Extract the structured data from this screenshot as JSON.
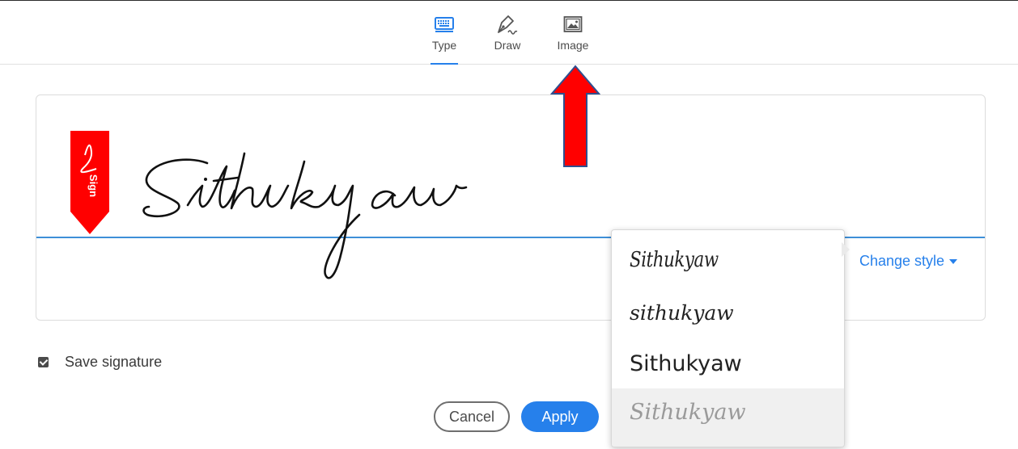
{
  "tabs": [
    {
      "label": "Type",
      "icon": "keyboard-icon",
      "active": true
    },
    {
      "label": "Draw",
      "icon": "pen-icon",
      "active": false
    },
    {
      "label": "Image",
      "icon": "image-icon",
      "active": false
    }
  ],
  "sign_tag": {
    "label": "Sign",
    "color": "#ff0000"
  },
  "signature": {
    "text": "Sithukyaw"
  },
  "change_style": {
    "label": "Change style"
  },
  "style_options": [
    "Sithukyaw",
    "sithukyaw",
    "Sithukyaw",
    "Sithukyaw"
  ],
  "save_signature": {
    "label": "Save signature",
    "checked": true
  },
  "buttons": {
    "cancel": "Cancel",
    "apply": "Apply"
  },
  "colors": {
    "accent": "#2680eb",
    "annotation_arrow": "#ff0000"
  }
}
